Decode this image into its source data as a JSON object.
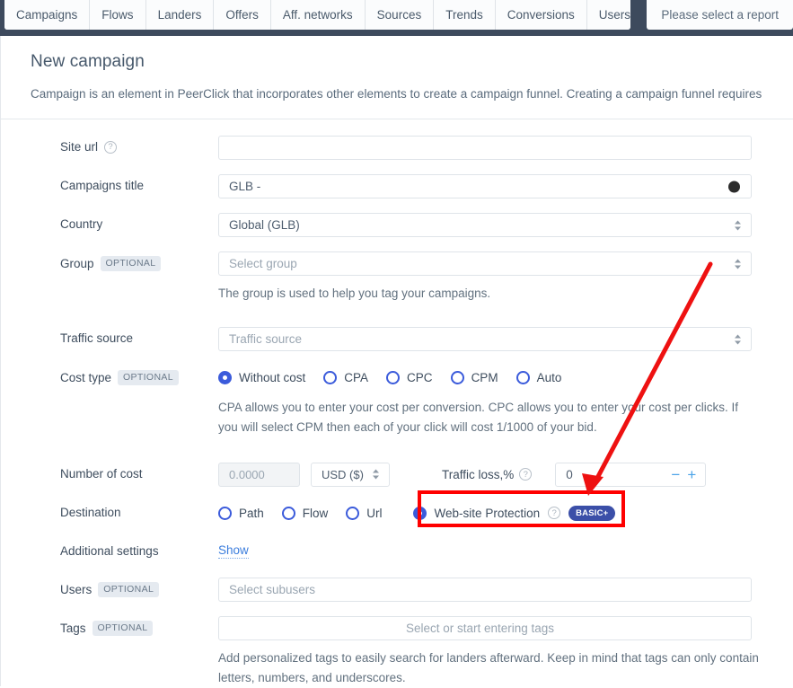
{
  "topbar": {
    "tabs": [
      {
        "label": "Campaigns"
      },
      {
        "label": "Flows"
      },
      {
        "label": "Landers"
      },
      {
        "label": "Offers"
      },
      {
        "label": "Aff. networks"
      },
      {
        "label": "Sources"
      },
      {
        "label": "Trends"
      },
      {
        "label": "Conversions"
      },
      {
        "label": "Users"
      }
    ],
    "report_placeholder": "Please select a report"
  },
  "header": {
    "title": "New campaign",
    "description": "Campaign is an element in PeerClick that incorporates other elements to create a campaign funnel. Creating a campaign funnel requires ad and not required for running the campaign."
  },
  "form": {
    "site_url": {
      "label": "Site url",
      "help_icon": "question-circle-icon",
      "value": ""
    },
    "campaigns_title": {
      "label": "Campaigns title",
      "value": "GLB -"
    },
    "country": {
      "label": "Country",
      "value": "Global (GLB)",
      "chevron_icon": "chevron-updown-icon"
    },
    "group": {
      "label": "Group",
      "optional_badge": "OPTIONAL",
      "placeholder": "Select group",
      "chevron_icon": "chevron-updown-icon",
      "hint": "The group is used to help you tag your campaigns."
    },
    "traffic_source": {
      "label": "Traffic source",
      "placeholder": "Traffic source",
      "chevron_icon": "chevron-updown-icon"
    },
    "cost_type": {
      "label": "Cost type",
      "optional_badge": "OPTIONAL",
      "options": [
        {
          "label": "Without cost",
          "selected": true
        },
        {
          "label": "CPA",
          "selected": false
        },
        {
          "label": "CPC",
          "selected": false
        },
        {
          "label": "CPM",
          "selected": false
        },
        {
          "label": "Auto",
          "selected": false
        }
      ],
      "hint": "CPA allows you to enter your cost per conversion. CPC allows you to enter your cost per clicks. If you will select CPM then each of your click will cost 1/1000 of your bid."
    },
    "number_of_cost": {
      "label": "Number of cost",
      "placeholder": "0.0000",
      "currency": "USD ($)",
      "currency_chevron_icon": "chevron-updown-icon",
      "traffic_loss_label": "Traffic loss,%",
      "traffic_loss_help_icon": "question-circle-icon",
      "traffic_loss_value": "0",
      "decrement_icon": "minus-icon",
      "increment_icon": "plus-icon"
    },
    "destination": {
      "label": "Destination",
      "options": [
        {
          "label": "Path",
          "selected": false
        },
        {
          "label": "Flow",
          "selected": false
        },
        {
          "label": "Url",
          "selected": false
        },
        {
          "label": "Web-site Protection",
          "selected": true,
          "help_icon": "question-circle-icon",
          "badge": "BASIC+"
        }
      ]
    },
    "additional_settings": {
      "label": "Additional settings",
      "show_link": "Show"
    },
    "users": {
      "label": "Users",
      "optional_badge": "OPTIONAL",
      "placeholder": "Select subusers"
    },
    "tags": {
      "label": "Tags",
      "optional_badge": "OPTIONAL",
      "placeholder": "Select or start entering tags",
      "hint": "Add personalized tags to easily search for landers afterward. Keep in mind that tags can only contain letters, numbers, and underscores."
    }
  },
  "annotation": {
    "highlight_color": "#ff0000",
    "arrow_color": "#ee1111"
  }
}
